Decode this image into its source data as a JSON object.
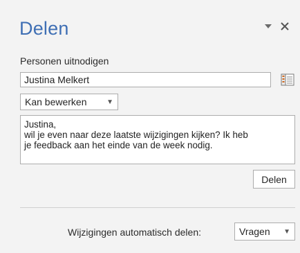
{
  "pane": {
    "title": "Delen",
    "controls": {
      "menu_icon": "chevron-down-icon",
      "close_icon": "close-icon"
    }
  },
  "invite": {
    "label": "Personen uitnodigen",
    "value": "Justina Melkert",
    "address_book_icon": "address-book-icon"
  },
  "permission": {
    "selected": "Kan bewerken"
  },
  "message": {
    "text": "Justina,\nwil je even naar deze laatste wijzigingen kijken? Ik heb\nje feedback aan het einde van de week nodig."
  },
  "share_button": {
    "label": "Delen"
  },
  "auto_share": {
    "label": "Wijzigingen automatisch delen:",
    "selected": "Vragen"
  },
  "colors": {
    "title": "#3f6fb4",
    "background": "#f3f3f3"
  }
}
